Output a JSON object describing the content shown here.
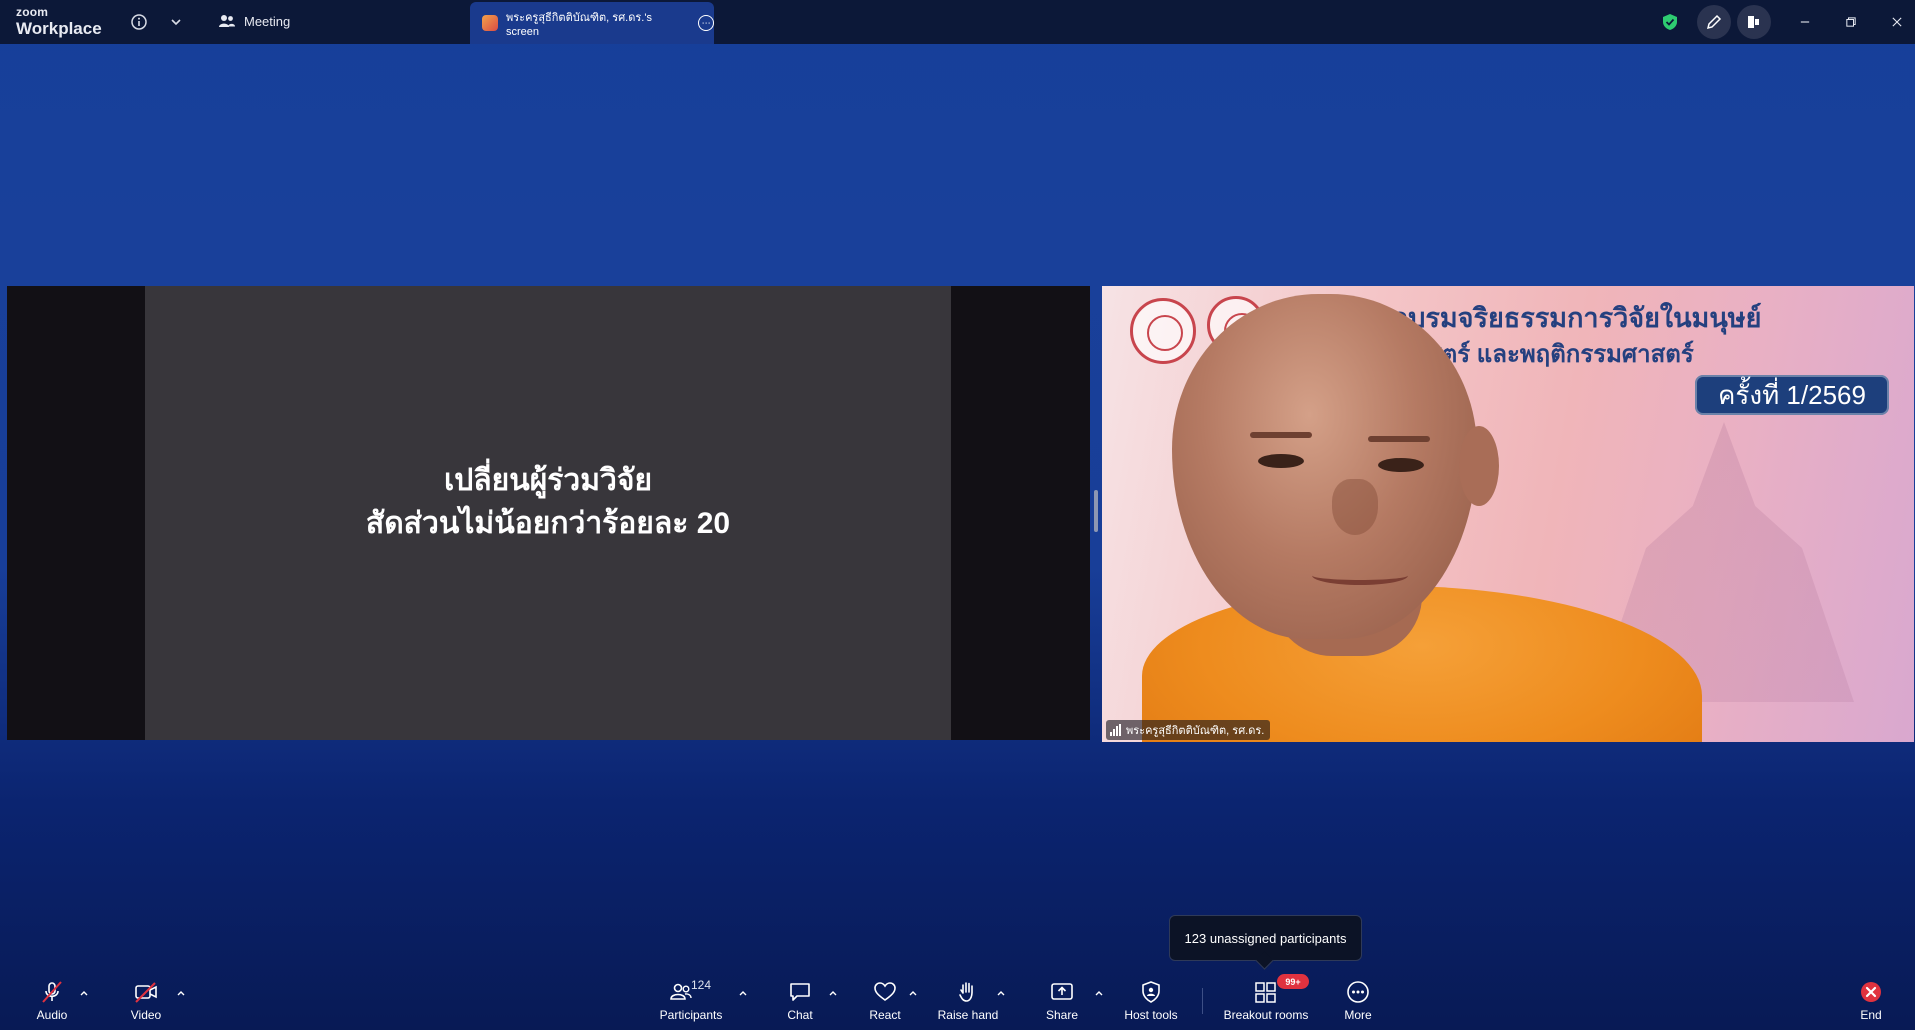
{
  "titlebar": {
    "logo_small": "zoom",
    "logo_big": "Workplace",
    "meeting_label": "Meeting",
    "screen_tab_label": "พระครูสุธีกิตติบัณฑิต, รศ.ดร.'s screen",
    "icons": [
      "info-icon",
      "chevron-down-icon",
      "participants-icon",
      "more-icon",
      "shield-icon",
      "pencil-icon",
      "sidebar-icon",
      "minimize-icon",
      "restore-icon",
      "close-icon"
    ],
    "shield_color": "#2ecc71"
  },
  "share": {
    "line1": "เปลี่ยนผู้ร่วมวิจัย",
    "line2": "สัดส่วนไม่น้อยกว่าร้อยละ 20"
  },
  "camera": {
    "banner_line1": "อบรมจริยธรรมการวิจัยในมนุษย์",
    "banner_line2": "สตร์ และพฤติกรรมศาสตร์",
    "badge": "ครั้งที่ 1/2569",
    "name_tag": "พระครูสุธีกิตติบัณฑิต, รศ.ดร."
  },
  "tooltip": {
    "text": "123 unassigned participants"
  },
  "toolbar": {
    "audio": "Audio",
    "video": "Video",
    "participants": "Participants",
    "participants_count": "124",
    "chat": "Chat",
    "react": "React",
    "raise_hand": "Raise hand",
    "share": "Share",
    "host_tools": "Host tools",
    "breakout_rooms": "Breakout rooms",
    "breakout_badge": "99+",
    "more": "More",
    "end": "End",
    "end_color": "#e0323f"
  }
}
